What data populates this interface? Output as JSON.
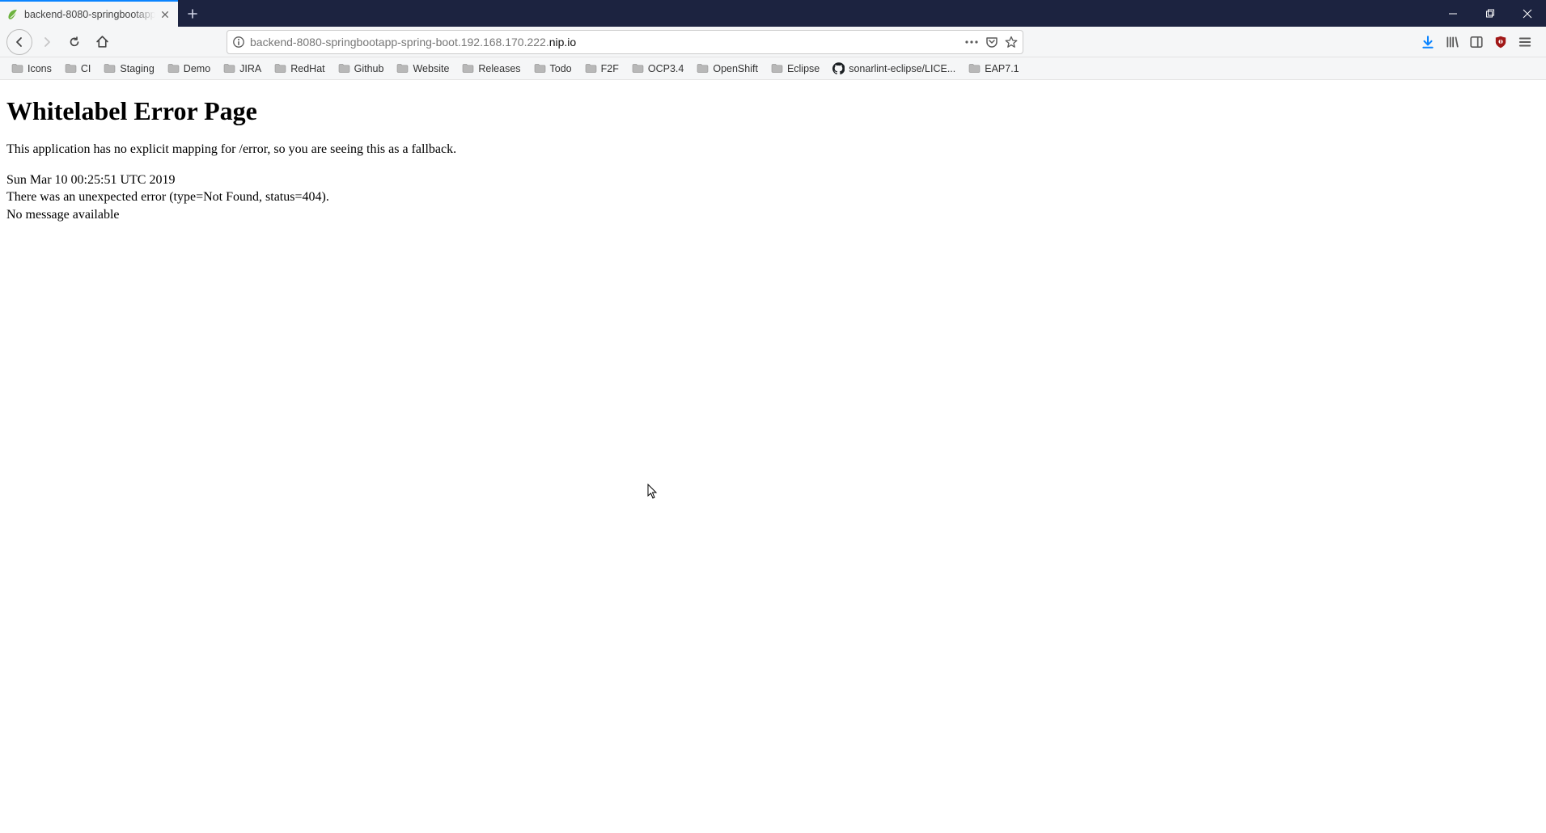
{
  "browser": {
    "tab": {
      "title": "backend-8080-springbootapp-",
      "favicon": "spring-leaf"
    },
    "url": {
      "prefix": "backend-8080-springbootapp-spring-boot.192.168.170.222.",
      "emphasis": "nip.io",
      "suffix": ""
    },
    "bookmarks": [
      {
        "label": "Icons",
        "icon": "folder"
      },
      {
        "label": "CI",
        "icon": "folder"
      },
      {
        "label": "Staging",
        "icon": "folder"
      },
      {
        "label": "Demo",
        "icon": "folder"
      },
      {
        "label": "JIRA",
        "icon": "folder"
      },
      {
        "label": "RedHat",
        "icon": "folder"
      },
      {
        "label": "Github",
        "icon": "folder"
      },
      {
        "label": "Website",
        "icon": "folder"
      },
      {
        "label": "Releases",
        "icon": "folder"
      },
      {
        "label": "Todo",
        "icon": "folder"
      },
      {
        "label": "F2F",
        "icon": "folder"
      },
      {
        "label": "OCP3.4",
        "icon": "folder"
      },
      {
        "label": "OpenShift",
        "icon": "folder"
      },
      {
        "label": "Eclipse",
        "icon": "folder"
      },
      {
        "label": "sonarlint-eclipse/LICE...",
        "icon": "github"
      },
      {
        "label": "EAP7.1",
        "icon": "folder"
      }
    ]
  },
  "page": {
    "heading": "Whitelabel Error Page",
    "paragraph": "This application has no explicit mapping for /error, so you are seeing this as a fallback.",
    "line1": "Sun Mar 10 00:25:51 UTC 2019",
    "line2": "There was an unexpected error (type=Not Found, status=404).",
    "line3": "No message available"
  }
}
